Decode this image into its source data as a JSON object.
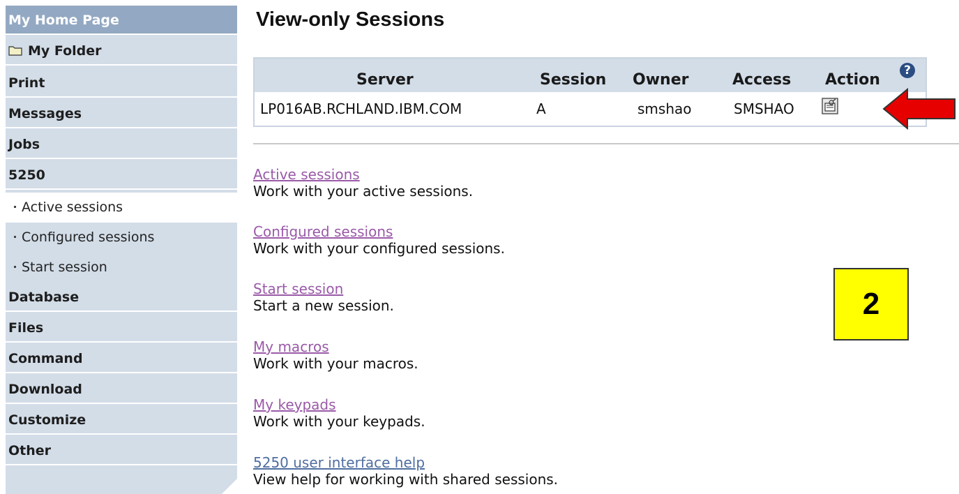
{
  "sidebar": {
    "home": "My Home Page",
    "folder": "My Folder",
    "items": [
      "Print",
      "Messages",
      "Jobs",
      "5250"
    ],
    "sub_items": [
      "Active sessions",
      "Configured sessions",
      "Start session"
    ],
    "items_after": [
      "Database",
      "Files",
      "Command",
      "Download",
      "Customize",
      "Other"
    ]
  },
  "main": {
    "title": "View-only Sessions",
    "table": {
      "headers": [
        "Server",
        "Session",
        "Owner",
        "Access",
        "Action"
      ],
      "row": [
        "LP016AB.RCHLAND.IBM.COM",
        "A",
        "smshao",
        "SMSHAO"
      ]
    },
    "help_icon_glyph": "?",
    "links": [
      {
        "label": "Active sessions",
        "desc": "Work with your active sessions."
      },
      {
        "label": "Configured sessions",
        "desc": "Work with your configured sessions."
      },
      {
        "label": "Start session",
        "desc": "Start a new session."
      },
      {
        "label": "My macros",
        "desc": "Work with your macros."
      },
      {
        "label": "My keypads",
        "desc": "Work with your keypads."
      },
      {
        "label": "5250 user interface help",
        "desc": "View help for working with shared sessions."
      }
    ]
  },
  "annotation": {
    "step_number": "2",
    "arrow_color": "#e60000",
    "box_color": "#ffff00"
  },
  "colors": {
    "sidebar_bg": "#d3dde8",
    "home_bg": "#93a8c2",
    "link_visited": "#9a5aa8",
    "link_help": "#4f6ea0"
  }
}
